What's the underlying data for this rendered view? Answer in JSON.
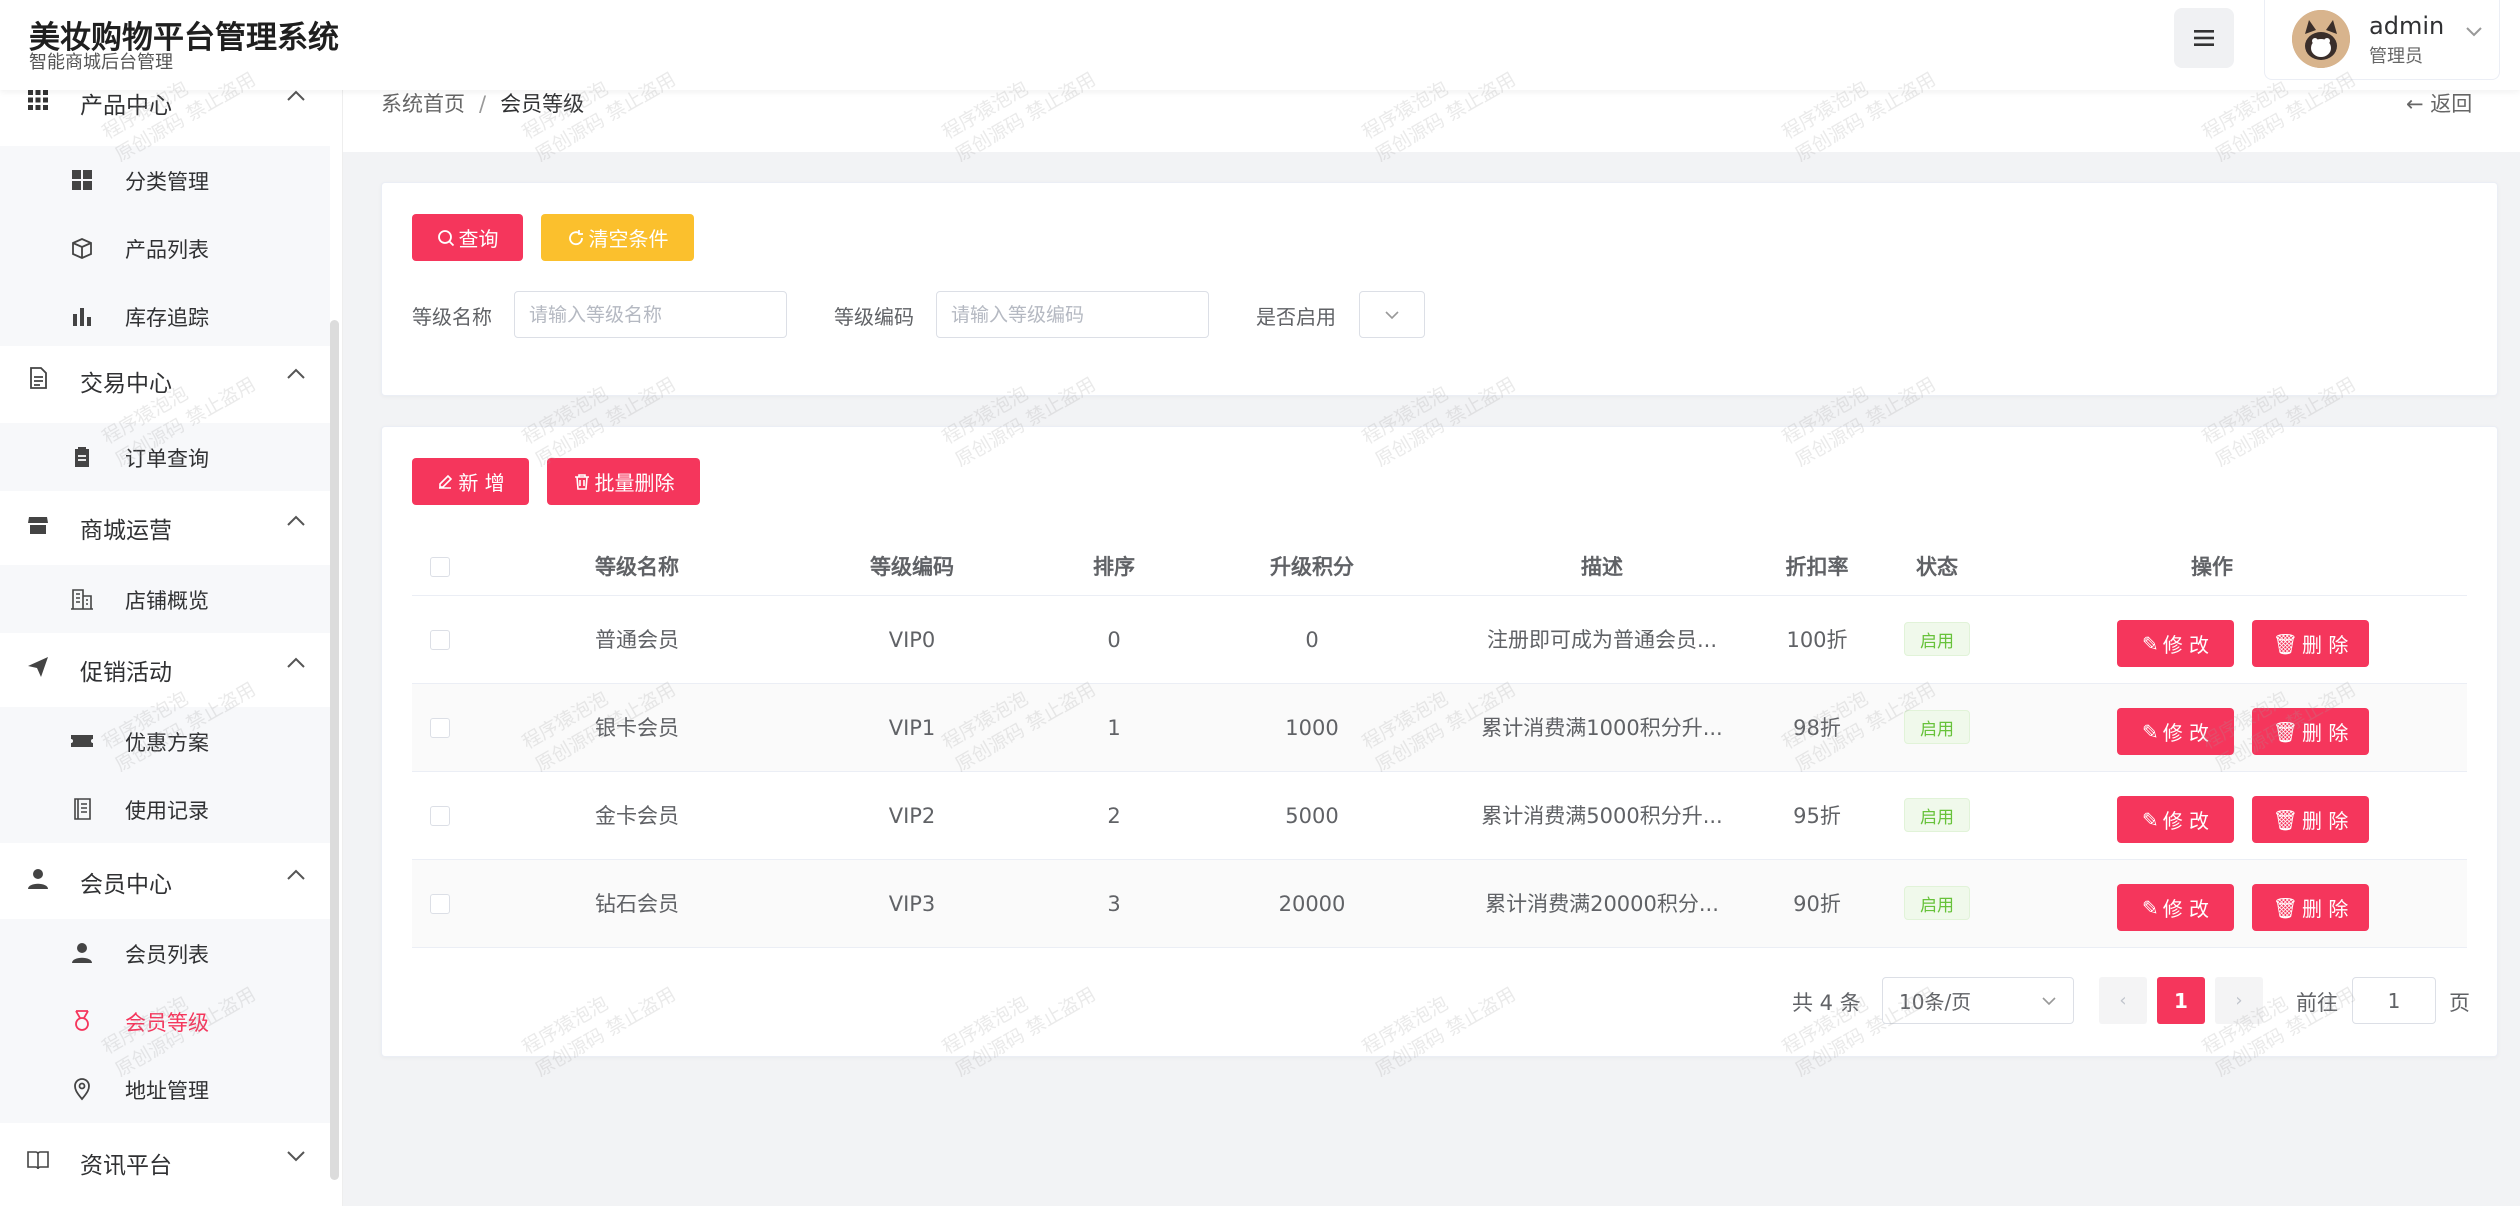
{
  "header": {
    "title": "美妆购物平台管理系统",
    "subtitle": "智能商城后台管理",
    "user_name": "admin",
    "user_role": "管理员"
  },
  "sidebar": {
    "groups": [
      {
        "label": "产品中心",
        "icon": "grid-icon",
        "items": [
          {
            "label": "分类管理",
            "icon": "apps-icon"
          },
          {
            "label": "产品列表",
            "icon": "box-icon"
          },
          {
            "label": "库存追踪",
            "icon": "bar-chart-icon"
          }
        ]
      },
      {
        "label": "交易中心",
        "icon": "document-icon",
        "items": [
          {
            "label": "订单查询",
            "icon": "clipboard-icon"
          }
        ]
      },
      {
        "label": "商城运营",
        "icon": "store-icon",
        "items": [
          {
            "label": "店铺概览",
            "icon": "building-icon"
          }
        ]
      },
      {
        "label": "促销活动",
        "icon": "send-icon",
        "items": [
          {
            "label": "优惠方案",
            "icon": "ticket-icon"
          },
          {
            "label": "使用记录",
            "icon": "notebook-icon"
          }
        ]
      },
      {
        "label": "会员中心",
        "icon": "user-icon",
        "items": [
          {
            "label": "会员列表",
            "icon": "user-icon"
          },
          {
            "label": "会员等级",
            "icon": "medal-icon",
            "active": true
          },
          {
            "label": "地址管理",
            "icon": "location-icon"
          }
        ]
      },
      {
        "label": "资讯平台",
        "icon": "book-icon",
        "items": []
      }
    ]
  },
  "breadcrumb": {
    "home": "系统首页",
    "separator": "/",
    "current": "会员等级",
    "back": "返回"
  },
  "search": {
    "query_button": "查询",
    "clear_button": "清空条件",
    "name_label": "等级名称",
    "name_placeholder": "请输入等级名称",
    "code_label": "等级编码",
    "code_placeholder": "请输入等级编码",
    "enabled_label": "是否启用"
  },
  "toolbar": {
    "add_button": "新 增",
    "batch_delete_button": "批量删除"
  },
  "table": {
    "columns": [
      "等级名称",
      "等级编码",
      "排序",
      "升级积分",
      "描述",
      "折扣率",
      "状态",
      "操作"
    ],
    "rows": [
      {
        "name": "普通会员",
        "code": "VIP0",
        "sort": "0",
        "points": "0",
        "desc": "注册即可成为普通会员...",
        "discount": "100折",
        "status": "启用"
      },
      {
        "name": "银卡会员",
        "code": "VIP1",
        "sort": "1",
        "points": "1000",
        "desc": "累计消费满1000积分升...",
        "discount": "98折",
        "status": "启用"
      },
      {
        "name": "金卡会员",
        "code": "VIP2",
        "sort": "2",
        "points": "5000",
        "desc": "累计消费满5000积分升...",
        "discount": "95折",
        "status": "启用"
      },
      {
        "name": "钻石会员",
        "code": "VIP3",
        "sort": "3",
        "points": "20000",
        "desc": "累计消费满20000积分...",
        "discount": "90折",
        "status": "启用"
      }
    ],
    "edit_label": "修 改",
    "delete_label": "删 除"
  },
  "pagination": {
    "total": "共 4 条",
    "page_size": "10条/页",
    "current_page": "1",
    "goto_label": "前往",
    "goto_value": "1",
    "page_suffix": "页"
  },
  "watermark": {
    "line1": "程序猿泡泡",
    "line2": "原创源码 禁止盗用"
  },
  "colors": {
    "accent": "#f5365c",
    "warning": "#fbc02d",
    "success": "#67c23a"
  }
}
